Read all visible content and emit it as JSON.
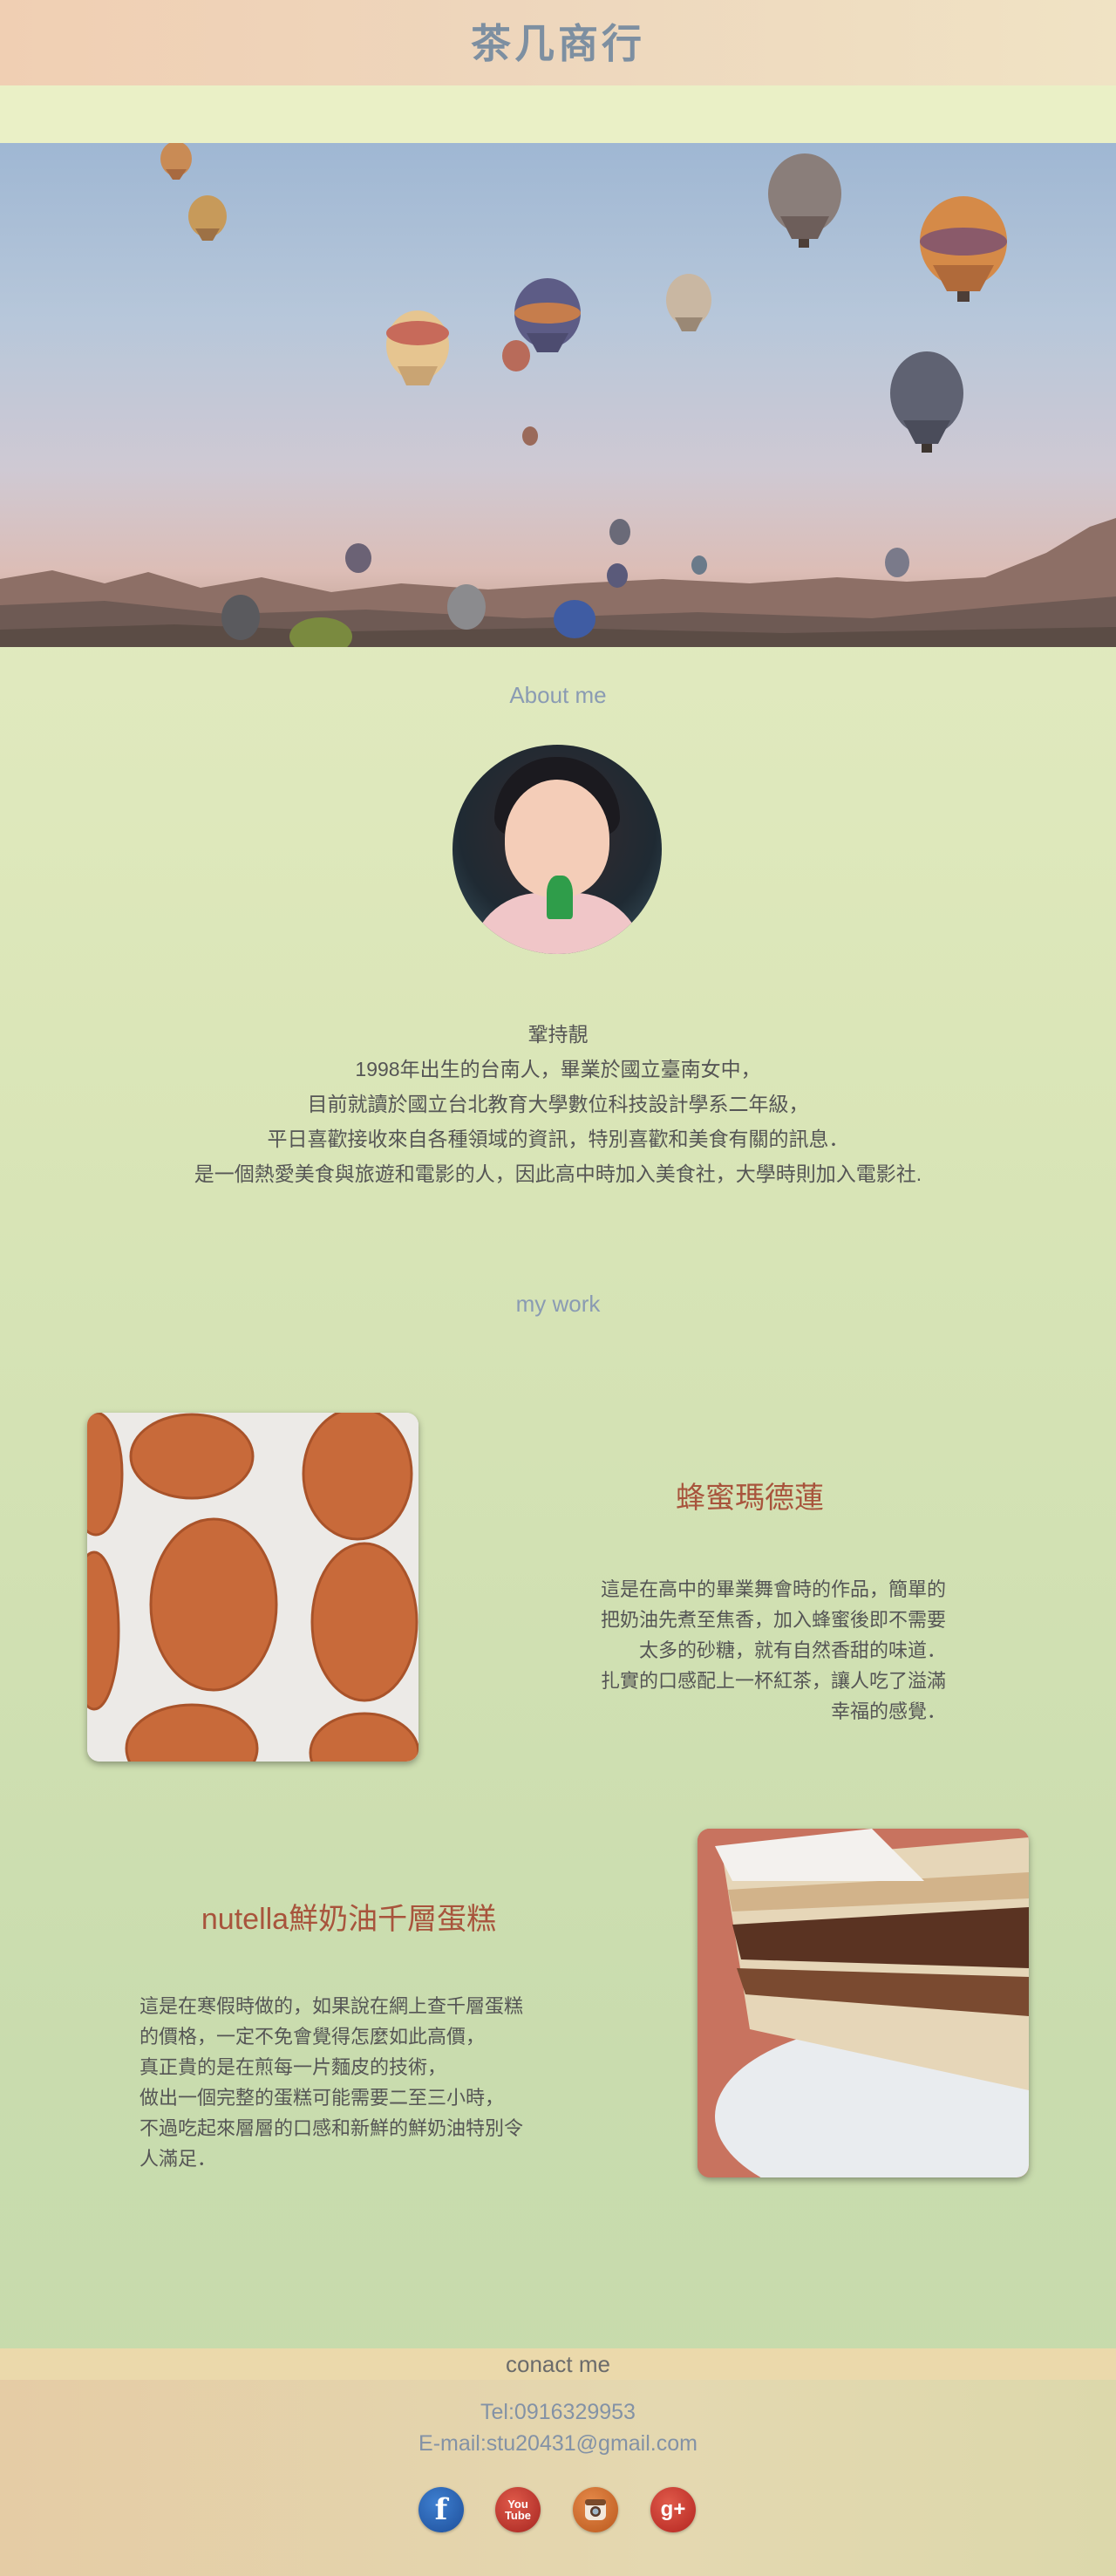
{
  "header": {
    "title": "茶几商行"
  },
  "about": {
    "heading": "About me",
    "name": "鞏持靚",
    "lines": [
      "1998年出生的台南人，畢業於國立臺南女中，",
      "目前就讀於國立台北教育大學數位科技設計學系二年級，",
      "平日喜歡接收來自各種領域的資訊，特別喜歡和美食有關的訊息．",
      "是一個熱愛美食與旅遊和電影的人，因此高中時加入美食社，大學時則加入電影社."
    ]
  },
  "work": {
    "heading": "my work",
    "items": [
      {
        "title": "蜂蜜瑪德蓮",
        "desc": [
          "這是在高中的畢業舞會時的作品，簡單的",
          "把奶油先煮至焦香，加入蜂蜜後即不需要",
          "太多的砂糖，就有自然香甜的味道．",
          "扎實的口感配上一杯紅茶，讓人吃了溢滿",
          "幸福的感覺．"
        ]
      },
      {
        "title": "nutella鮮奶油千層蛋糕",
        "desc": [
          "這是在寒假時做的，如果說在網上查千層蛋糕",
          "的價格，一定不免會覺得怎麼如此高價，",
          "真正貴的是在煎每一片麵皮的技術，",
          "做出一個完整的蛋糕可能需要二至三小時，",
          "不過吃起來層層的口感和新鮮的鮮奶油特別令",
          "人滿足．"
        ]
      }
    ]
  },
  "contact": {
    "heading": "conact me",
    "tel": "Tel:0916329953",
    "email": "E-mail:stu20431@gmail.com",
    "social": [
      {
        "icon": "facebook-icon",
        "glyph": "f"
      },
      {
        "icon": "youtube-icon",
        "glyph_top": "You",
        "glyph_bottom": "Tube"
      },
      {
        "icon": "instagram-icon"
      },
      {
        "icon": "google-plus-icon",
        "glyph": "g+"
      }
    ]
  }
}
